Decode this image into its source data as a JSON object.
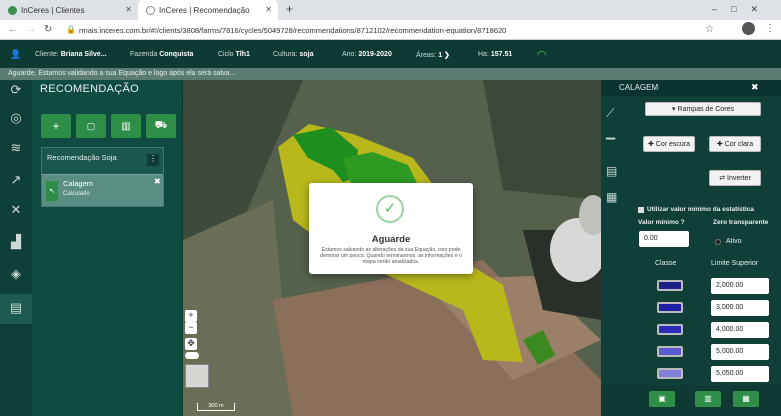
{
  "browser": {
    "tabs": [
      {
        "title": "InCeres | Clientes"
      },
      {
        "title": "InCeres | Recomendação"
      }
    ],
    "url": "rmais.inceres.com.br/#!/clients/3808/farms/7816/cycles/5049728/recommendations/8712102/recommendation-equation/8718620"
  },
  "appbar": {
    "cliente_label": "Cliente:",
    "cliente": "Briana Silve...",
    "fazenda_label": "Fazenda",
    "fazenda": "Conquista",
    "ciclo_label": "Ciclo",
    "ciclo": "Tlh1",
    "cultura_label": "Cultura:",
    "cultura": "soja",
    "ano_label": "Ano:",
    "ano": "2019-2020",
    "areas_label": "Áreas:",
    "areas": "1",
    "ha_label": "Ha:",
    "ha": "157.51"
  },
  "banner": "Aguarde, Estamos validando a sua Equação e logo após ela será salva...",
  "left": {
    "title": "RECOMENDAÇÃO",
    "card_title": "Recomendação Soja",
    "item_title": "Calagem",
    "item_status": "Calculado"
  },
  "modal": {
    "title": "Aguarde",
    "message": "Estamos salvando as alterações da sua Equação, isso pode demorar um pouco. Quando terminarmos, as informações e o mapa serão atualizados."
  },
  "map": {
    "scale": "300 m"
  },
  "right": {
    "title": "CALAGEM",
    "rampas": "Rampas de Cores",
    "cor_escura": "Cor escura",
    "cor_clara": "Cor clara",
    "inverter": "Inverter",
    "usar_minimo": "Utilizar valor mínimo da estatística",
    "valor_minimo_label": "Valor mínimo",
    "zero_label": "Zero transparente",
    "valor_minimo": "0.00",
    "ativo": "Ativo",
    "classe_label": "Classe",
    "limite_label": "Limite Superior",
    "classes": [
      {
        "color": "#1c1f85",
        "limit": "2,000.00"
      },
      {
        "color": "#1e1fa3",
        "limit": "3,000.00"
      },
      {
        "color": "#2a2bb8",
        "limit": "4,000.00"
      },
      {
        "color": "#5a5bd0",
        "limit": "5,000.00"
      },
      {
        "color": "#7f80d6",
        "limit": "5,050.00"
      }
    ]
  }
}
